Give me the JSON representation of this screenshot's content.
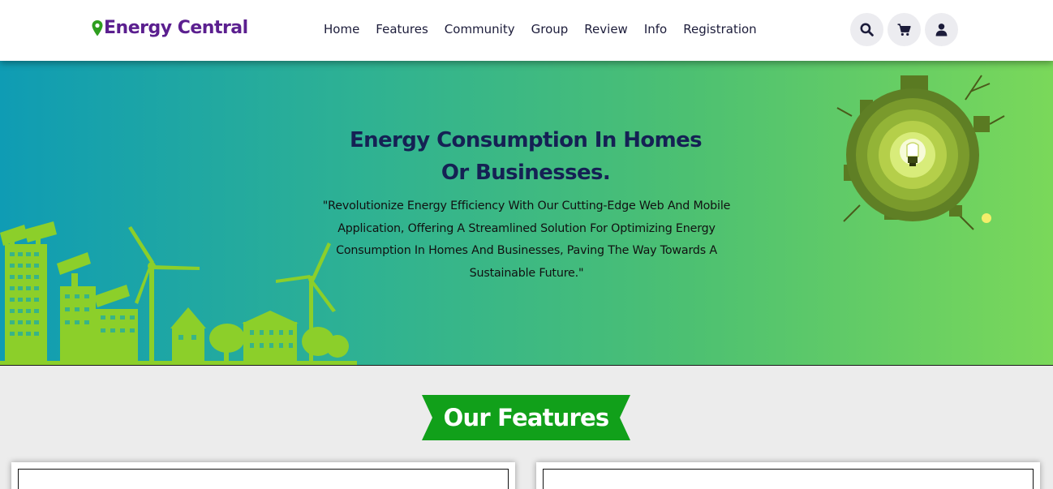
{
  "header": {
    "brand": "Energy Central",
    "nav": [
      "Home",
      "Features",
      "Community",
      "Group",
      "Review",
      "Info",
      "Registration"
    ],
    "icons": [
      "search-icon",
      "cart-icon",
      "user-icon"
    ]
  },
  "hero": {
    "title_line1": "Energy Consumption In Homes",
    "title_line2": "Or Businesses.",
    "description": "\"Revolutionize Energy Efficiency With Our Cutting-Edge Web And Mobile Application, Offering A Streamlined Solution For Optimizing Energy Consumption In Homes And Businesses, Paving The Way Towards A Sustainable Future.\""
  },
  "features": {
    "heading": "Our Features"
  },
  "colors": {
    "brand": "#5b1f8f",
    "pin": "#2e9e1f",
    "banner": "#11a01a",
    "hero_start": "#0f9cb4",
    "hero_end": "#7ad85a",
    "hero_title": "#152154"
  }
}
